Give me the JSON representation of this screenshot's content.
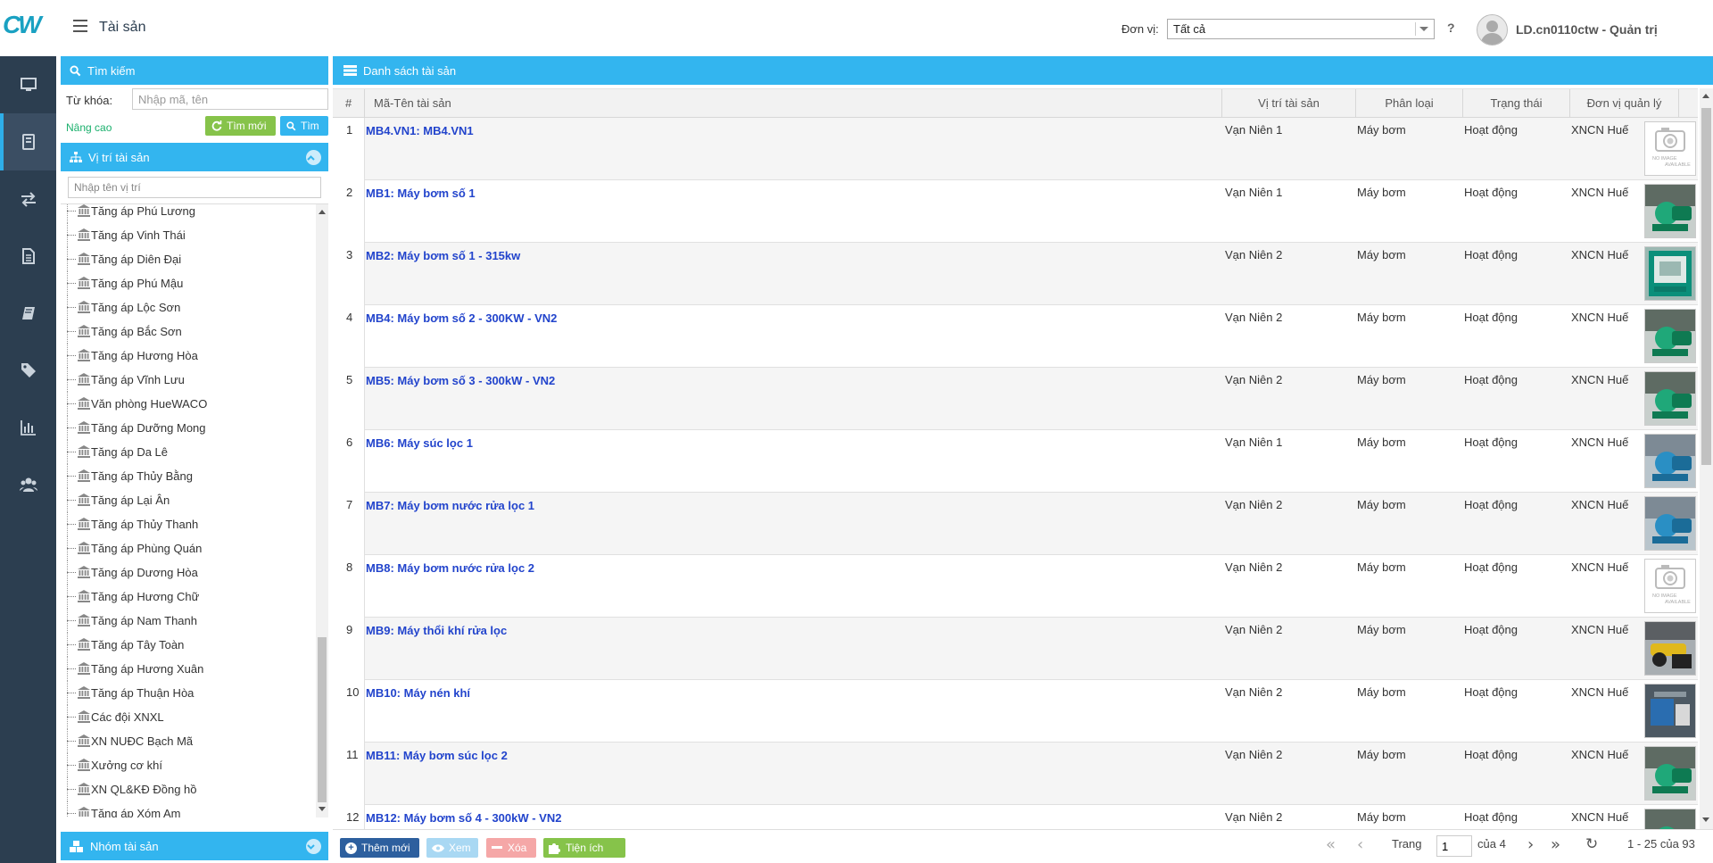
{
  "header": {
    "logo_text": "CW",
    "page_title": "Tài sản",
    "unit_label": "Đơn vị:",
    "unit_selected": "Tất cả",
    "help": "?",
    "user": "LD.cn0110ctw - Quản trị"
  },
  "nav": [
    "monitor-icon",
    "tablet-icon",
    "exchange-icon",
    "document-icon",
    "book-icon",
    "tags-icon",
    "bar-chart-icon",
    "users-icon"
  ],
  "search": {
    "title": "Tìm kiếm",
    "keyword_label": "Từ khóa:",
    "keyword_placeholder": "Nhập mã, tên",
    "advanced": "Nâng cao",
    "reset_label": "Tìm mới",
    "find_label": "Tìm"
  },
  "locations": {
    "title": "Vị trí tài sản",
    "filter_placeholder": "Nhập tên vị trí",
    "items": [
      "Tăng áp Phú Lương",
      "Tăng áp Vinh Thái",
      "Tăng áp Diên Đại",
      "Tăng áp Phú Mậu",
      "Tăng áp Lộc Sơn",
      "Tăng áp Bắc Sơn",
      "Tăng áp Hương Hòa",
      "Tăng áp Vĩnh Lưu",
      "Văn phòng HueWACO",
      "Tăng áp Dưỡng Mong",
      "Tăng áp Da Lê",
      "Tăng áp Thủy Bằng",
      "Tăng áp Lại Ân",
      "Tăng áp Thủy Thanh",
      "Tăng áp Phùng Quán",
      "Tăng áp Dương Hòa",
      "Tăng áp Hương Chữ",
      "Tăng áp Nam Thanh",
      "Tăng áp Tây Toàn",
      "Tăng áp Hương Xuân",
      "Tăng áp Thuận Hòa",
      "Các đội XNXL",
      "XN NUĐC Bạch Mã",
      "Xưởng cơ khí",
      "XN QL&KĐ Đồng hồ",
      "Tăng áp Xóm Am"
    ]
  },
  "groups": {
    "title": "Nhóm tài sản"
  },
  "list": {
    "title": "Danh sách tài sản",
    "columns": [
      "#",
      "Mã-Tên tài sản",
      "Vị trí tài sản",
      "Phân loại",
      "Trạng thái",
      "Đơn vị quản lý"
    ],
    "rows": [
      {
        "n": "1",
        "name": "MB4.VN1: MB4.VN1",
        "loc": "Vạn Niên 1",
        "type": "Máy bơm",
        "status": "Hoạt động",
        "unit": "XNCN Huế",
        "img": "none"
      },
      {
        "n": "2",
        "name": "MB1: Máy bơm số 1",
        "loc": "Vạn Niên 1",
        "type": "Máy bơm",
        "status": "Hoạt động",
        "unit": "XNCN Huế",
        "img": "pump-green"
      },
      {
        "n": "3",
        "name": "MB2: Máy bơm số 1 - 315kw",
        "loc": "Vạn Niên 2",
        "type": "Máy bơm",
        "status": "Hoạt động",
        "unit": "XNCN Huế",
        "img": "cabinet-teal"
      },
      {
        "n": "4",
        "name": "MB4: Máy bơm số 2 - 300KW - VN2",
        "loc": "Vạn Niên 2",
        "type": "Máy bơm",
        "status": "Hoạt động",
        "unit": "XNCN Huế",
        "img": "pump-green"
      },
      {
        "n": "5",
        "name": "MB5: Máy bơm số 3 - 300kW - VN2",
        "loc": "Vạn Niên 2",
        "type": "Máy bơm",
        "status": "Hoạt động",
        "unit": "XNCN Huế",
        "img": "pump-green"
      },
      {
        "n": "6",
        "name": "MB6: Máy súc lọc 1",
        "loc": "Vạn Niên 1",
        "type": "Máy bơm",
        "status": "Hoạt động",
        "unit": "XNCN Huế",
        "img": "pump-blue"
      },
      {
        "n": "7",
        "name": "MB7: Máy bơm nước rửa lọc 1",
        "loc": "Vạn Niên 2",
        "type": "Máy bơm",
        "status": "Hoạt động",
        "unit": "XNCN Huế",
        "img": "pump-blue"
      },
      {
        "n": "8",
        "name": "MB8: Máy bơm nước rửa lọc 2",
        "loc": "Vạn Niên 2",
        "type": "Máy bơm",
        "status": "Hoạt động",
        "unit": "XNCN Huế",
        "img": "none"
      },
      {
        "n": "9",
        "name": "MB9: Máy thổi khí rửa lọc",
        "loc": "Vạn Niên 2",
        "type": "Máy bơm",
        "status": "Hoạt động",
        "unit": "XNCN Huế",
        "img": "blower-yellow"
      },
      {
        "n": "10",
        "name": "MB10: Máy nén khí",
        "loc": "Vạn Niên 2",
        "type": "Máy bơm",
        "status": "Hoạt động",
        "unit": "XNCN Huế",
        "img": "compressor-blue"
      },
      {
        "n": "11",
        "name": "MB11: Máy bơm súc lọc 2",
        "loc": "Vạn Niên 2",
        "type": "Máy bơm",
        "status": "Hoạt động",
        "unit": "XNCN Huế",
        "img": "pump-green"
      },
      {
        "n": "12",
        "name": "MB12: Máy bơm số 4 - 300kW - VN2",
        "loc": "Vạn Niên 2",
        "type": "Máy bơm",
        "status": "Hoạt động",
        "unit": "XNCN Huế",
        "img": "pump-green"
      }
    ],
    "no_image_text": [
      "NO IMAGE",
      "AVAILABLE"
    ]
  },
  "footer": {
    "add": "Thêm mới",
    "view": "Xem",
    "delete": "Xóa",
    "utility": "Tiện ích",
    "page_label": "Trang",
    "page_value": "1",
    "page_of": "của 4",
    "range": "1 - 25 của 93"
  },
  "colors": {
    "accent": "#33b5ef",
    "nav_bg": "#2c3e50",
    "link": "#2244cc",
    "green": "#86c34a",
    "add": "#2d5f9e"
  }
}
